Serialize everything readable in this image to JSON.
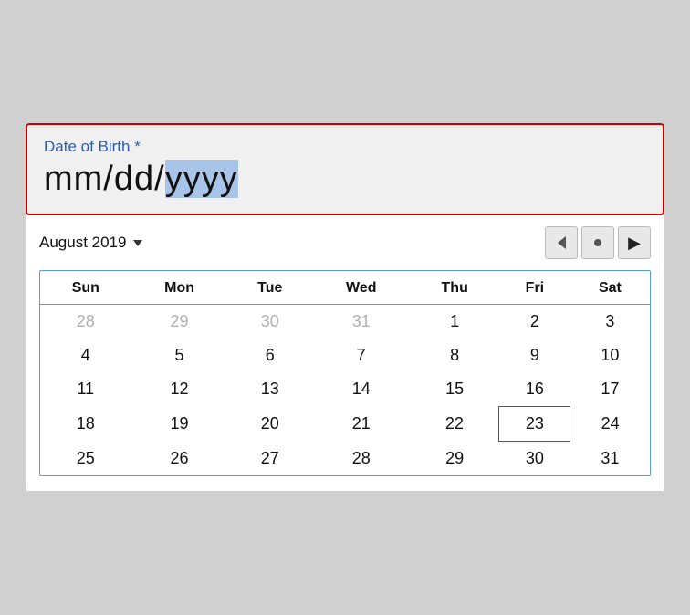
{
  "dobField": {
    "label": "Date of Birth *",
    "valuePlain": "mm/dd/",
    "valueHighlight": "yyyy"
  },
  "calendar": {
    "monthYear": "August 2019",
    "dropdownArrow": "▼",
    "navPrev": "◀",
    "navDot": "•",
    "navNext": "▶",
    "weekdays": [
      "Sun",
      "Mon",
      "Tue",
      "Wed",
      "Thu",
      "Fri",
      "Sat"
    ],
    "weeks": [
      [
        {
          "day": "28",
          "otherMonth": true
        },
        {
          "day": "29",
          "otherMonth": true
        },
        {
          "day": "30",
          "otherMonth": true
        },
        {
          "day": "31",
          "otherMonth": true
        },
        {
          "day": "1",
          "otherMonth": false
        },
        {
          "day": "2",
          "otherMonth": false
        },
        {
          "day": "3",
          "otherMonth": false
        }
      ],
      [
        {
          "day": "4",
          "otherMonth": false
        },
        {
          "day": "5",
          "otherMonth": false
        },
        {
          "day": "6",
          "otherMonth": false
        },
        {
          "day": "7",
          "otherMonth": false
        },
        {
          "day": "8",
          "otherMonth": false
        },
        {
          "day": "9",
          "otherMonth": false
        },
        {
          "day": "10",
          "otherMonth": false
        }
      ],
      [
        {
          "day": "11",
          "otherMonth": false
        },
        {
          "day": "12",
          "otherMonth": false
        },
        {
          "day": "13",
          "otherMonth": false
        },
        {
          "day": "14",
          "otherMonth": false
        },
        {
          "day": "15",
          "otherMonth": false
        },
        {
          "day": "16",
          "otherMonth": false
        },
        {
          "day": "17",
          "otherMonth": false
        }
      ],
      [
        {
          "day": "18",
          "otherMonth": false
        },
        {
          "day": "19",
          "otherMonth": false
        },
        {
          "day": "20",
          "otherMonth": false
        },
        {
          "day": "21",
          "otherMonth": false
        },
        {
          "day": "22",
          "otherMonth": false
        },
        {
          "day": "23",
          "otherMonth": false,
          "today": true
        },
        {
          "day": "24",
          "otherMonth": false
        }
      ],
      [
        {
          "day": "25",
          "otherMonth": false
        },
        {
          "day": "26",
          "otherMonth": false
        },
        {
          "day": "27",
          "otherMonth": false
        },
        {
          "day": "28",
          "otherMonth": false
        },
        {
          "day": "29",
          "otherMonth": false
        },
        {
          "day": "30",
          "otherMonth": false
        },
        {
          "day": "31",
          "otherMonth": false
        }
      ]
    ]
  }
}
